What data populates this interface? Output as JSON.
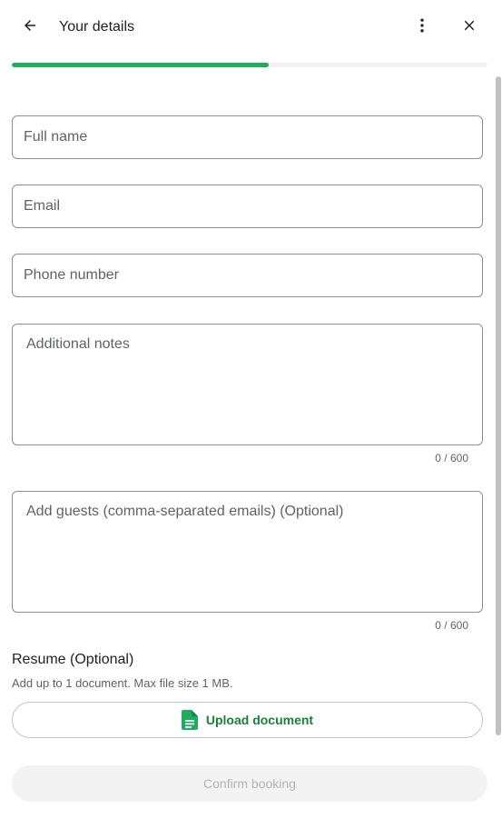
{
  "header": {
    "title": "Your details",
    "back_icon": "arrow-back-icon",
    "more_icon": "more-vert-icon",
    "close_icon": "close-icon"
  },
  "progress": {
    "value_percent": 54,
    "color": "#1ead5e"
  },
  "form": {
    "full_name": {
      "placeholder": "Full name",
      "value": ""
    },
    "email": {
      "placeholder": "Email",
      "value": ""
    },
    "phone": {
      "placeholder": "Phone number",
      "value": ""
    },
    "notes": {
      "placeholder": "Additional notes",
      "value": "",
      "counter": "0 / 600"
    },
    "guests": {
      "placeholder": "Add guests (comma-separated emails) (Optional)",
      "value": "",
      "counter": "0 / 600"
    }
  },
  "resume": {
    "title": "Resume (Optional)",
    "subtitle": "Add up to 1 document. Max file size 1 MB.",
    "upload_label": "Upload document",
    "upload_icon": "document-icon",
    "accent_color": "#188038"
  },
  "footer": {
    "confirm_label": "Confirm booking",
    "state": "disabled"
  }
}
